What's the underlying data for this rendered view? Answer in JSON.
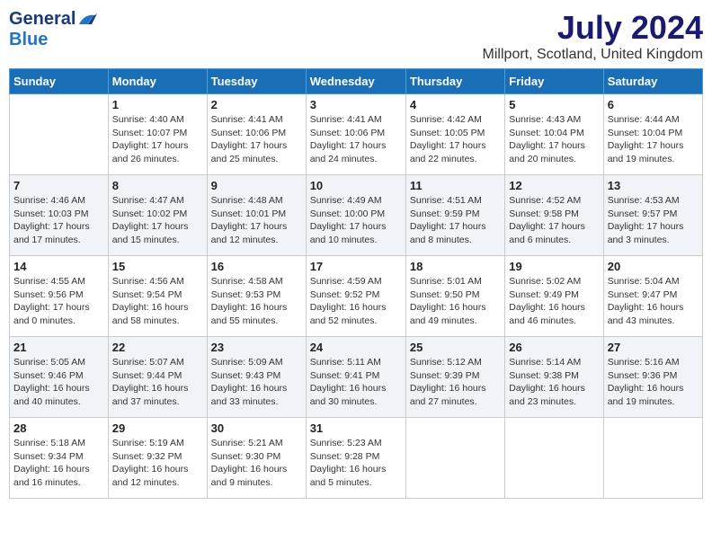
{
  "logo": {
    "general": "General",
    "blue": "Blue"
  },
  "title": "July 2024",
  "location": "Millport, Scotland, United Kingdom",
  "days_of_week": [
    "Sunday",
    "Monday",
    "Tuesday",
    "Wednesday",
    "Thursday",
    "Friday",
    "Saturday"
  ],
  "weeks": [
    [
      {
        "day": "",
        "info": ""
      },
      {
        "day": "1",
        "info": "Sunrise: 4:40 AM\nSunset: 10:07 PM\nDaylight: 17 hours\nand 26 minutes."
      },
      {
        "day": "2",
        "info": "Sunrise: 4:41 AM\nSunset: 10:06 PM\nDaylight: 17 hours\nand 25 minutes."
      },
      {
        "day": "3",
        "info": "Sunrise: 4:41 AM\nSunset: 10:06 PM\nDaylight: 17 hours\nand 24 minutes."
      },
      {
        "day": "4",
        "info": "Sunrise: 4:42 AM\nSunset: 10:05 PM\nDaylight: 17 hours\nand 22 minutes."
      },
      {
        "day": "5",
        "info": "Sunrise: 4:43 AM\nSunset: 10:04 PM\nDaylight: 17 hours\nand 20 minutes."
      },
      {
        "day": "6",
        "info": "Sunrise: 4:44 AM\nSunset: 10:04 PM\nDaylight: 17 hours\nand 19 minutes."
      }
    ],
    [
      {
        "day": "7",
        "info": "Sunrise: 4:46 AM\nSunset: 10:03 PM\nDaylight: 17 hours\nand 17 minutes."
      },
      {
        "day": "8",
        "info": "Sunrise: 4:47 AM\nSunset: 10:02 PM\nDaylight: 17 hours\nand 15 minutes."
      },
      {
        "day": "9",
        "info": "Sunrise: 4:48 AM\nSunset: 10:01 PM\nDaylight: 17 hours\nand 12 minutes."
      },
      {
        "day": "10",
        "info": "Sunrise: 4:49 AM\nSunset: 10:00 PM\nDaylight: 17 hours\nand 10 minutes."
      },
      {
        "day": "11",
        "info": "Sunrise: 4:51 AM\nSunset: 9:59 PM\nDaylight: 17 hours\nand 8 minutes."
      },
      {
        "day": "12",
        "info": "Sunrise: 4:52 AM\nSunset: 9:58 PM\nDaylight: 17 hours\nand 6 minutes."
      },
      {
        "day": "13",
        "info": "Sunrise: 4:53 AM\nSunset: 9:57 PM\nDaylight: 17 hours\nand 3 minutes."
      }
    ],
    [
      {
        "day": "14",
        "info": "Sunrise: 4:55 AM\nSunset: 9:56 PM\nDaylight: 17 hours\nand 0 minutes."
      },
      {
        "day": "15",
        "info": "Sunrise: 4:56 AM\nSunset: 9:54 PM\nDaylight: 16 hours\nand 58 minutes."
      },
      {
        "day": "16",
        "info": "Sunrise: 4:58 AM\nSunset: 9:53 PM\nDaylight: 16 hours\nand 55 minutes."
      },
      {
        "day": "17",
        "info": "Sunrise: 4:59 AM\nSunset: 9:52 PM\nDaylight: 16 hours\nand 52 minutes."
      },
      {
        "day": "18",
        "info": "Sunrise: 5:01 AM\nSunset: 9:50 PM\nDaylight: 16 hours\nand 49 minutes."
      },
      {
        "day": "19",
        "info": "Sunrise: 5:02 AM\nSunset: 9:49 PM\nDaylight: 16 hours\nand 46 minutes."
      },
      {
        "day": "20",
        "info": "Sunrise: 5:04 AM\nSunset: 9:47 PM\nDaylight: 16 hours\nand 43 minutes."
      }
    ],
    [
      {
        "day": "21",
        "info": "Sunrise: 5:05 AM\nSunset: 9:46 PM\nDaylight: 16 hours\nand 40 minutes."
      },
      {
        "day": "22",
        "info": "Sunrise: 5:07 AM\nSunset: 9:44 PM\nDaylight: 16 hours\nand 37 minutes."
      },
      {
        "day": "23",
        "info": "Sunrise: 5:09 AM\nSunset: 9:43 PM\nDaylight: 16 hours\nand 33 minutes."
      },
      {
        "day": "24",
        "info": "Sunrise: 5:11 AM\nSunset: 9:41 PM\nDaylight: 16 hours\nand 30 minutes."
      },
      {
        "day": "25",
        "info": "Sunrise: 5:12 AM\nSunset: 9:39 PM\nDaylight: 16 hours\nand 27 minutes."
      },
      {
        "day": "26",
        "info": "Sunrise: 5:14 AM\nSunset: 9:38 PM\nDaylight: 16 hours\nand 23 minutes."
      },
      {
        "day": "27",
        "info": "Sunrise: 5:16 AM\nSunset: 9:36 PM\nDaylight: 16 hours\nand 19 minutes."
      }
    ],
    [
      {
        "day": "28",
        "info": "Sunrise: 5:18 AM\nSunset: 9:34 PM\nDaylight: 16 hours\nand 16 minutes."
      },
      {
        "day": "29",
        "info": "Sunrise: 5:19 AM\nSunset: 9:32 PM\nDaylight: 16 hours\nand 12 minutes."
      },
      {
        "day": "30",
        "info": "Sunrise: 5:21 AM\nSunset: 9:30 PM\nDaylight: 16 hours\nand 9 minutes."
      },
      {
        "day": "31",
        "info": "Sunrise: 5:23 AM\nSunset: 9:28 PM\nDaylight: 16 hours\nand 5 minutes."
      },
      {
        "day": "",
        "info": ""
      },
      {
        "day": "",
        "info": ""
      },
      {
        "day": "",
        "info": ""
      }
    ]
  ]
}
